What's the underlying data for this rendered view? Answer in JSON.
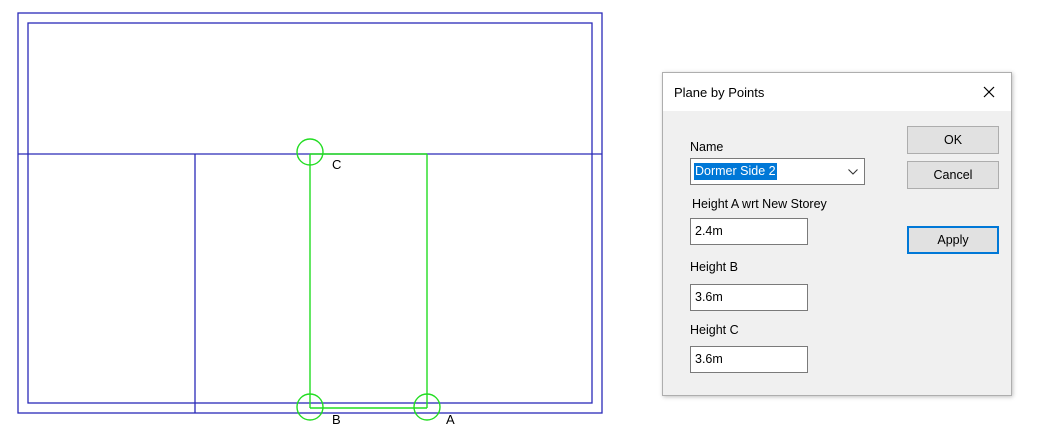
{
  "drawing": {
    "point_labels": {
      "a": "A",
      "b": "B",
      "c": "C"
    },
    "colors": {
      "plan_lines": "#2a2ab8",
      "plane_lines": "#22dd22"
    }
  },
  "dialog": {
    "title": "Plane by Points",
    "close_icon": "close-icon",
    "name_label": "Name",
    "name_value": "Dormer Side 2",
    "height_a_label": "Height A wrt New Storey",
    "height_a_value": "2.4m",
    "height_b_label": "Height B",
    "height_b_value": "3.6m",
    "height_c_label": "Height C",
    "height_c_value": "3.6m",
    "ok_label": "OK",
    "cancel_label": "Cancel",
    "apply_label": "Apply"
  }
}
